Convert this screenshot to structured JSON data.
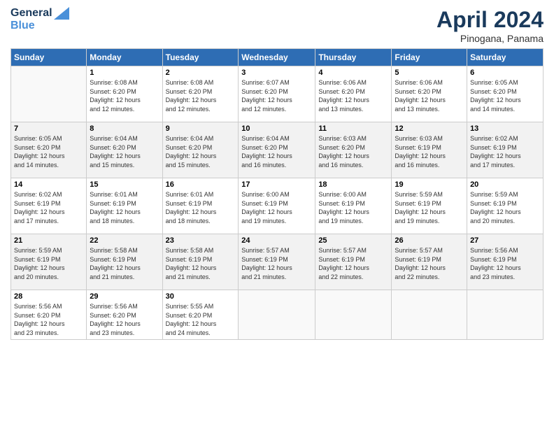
{
  "logo": {
    "line1": "General",
    "line2": "Blue"
  },
  "title": "April 2024",
  "subtitle": "Pinogana, Panama",
  "headers": [
    "Sunday",
    "Monday",
    "Tuesday",
    "Wednesday",
    "Thursday",
    "Friday",
    "Saturday"
  ],
  "weeks": [
    [
      {
        "day": "",
        "info": ""
      },
      {
        "day": "1",
        "info": "Sunrise: 6:08 AM\nSunset: 6:20 PM\nDaylight: 12 hours\nand 12 minutes."
      },
      {
        "day": "2",
        "info": "Sunrise: 6:08 AM\nSunset: 6:20 PM\nDaylight: 12 hours\nand 12 minutes."
      },
      {
        "day": "3",
        "info": "Sunrise: 6:07 AM\nSunset: 6:20 PM\nDaylight: 12 hours\nand 12 minutes."
      },
      {
        "day": "4",
        "info": "Sunrise: 6:06 AM\nSunset: 6:20 PM\nDaylight: 12 hours\nand 13 minutes."
      },
      {
        "day": "5",
        "info": "Sunrise: 6:06 AM\nSunset: 6:20 PM\nDaylight: 12 hours\nand 13 minutes."
      },
      {
        "day": "6",
        "info": "Sunrise: 6:05 AM\nSunset: 6:20 PM\nDaylight: 12 hours\nand 14 minutes."
      }
    ],
    [
      {
        "day": "7",
        "info": "Sunrise: 6:05 AM\nSunset: 6:20 PM\nDaylight: 12 hours\nand 14 minutes."
      },
      {
        "day": "8",
        "info": "Sunrise: 6:04 AM\nSunset: 6:20 PM\nDaylight: 12 hours\nand 15 minutes."
      },
      {
        "day": "9",
        "info": "Sunrise: 6:04 AM\nSunset: 6:20 PM\nDaylight: 12 hours\nand 15 minutes."
      },
      {
        "day": "10",
        "info": "Sunrise: 6:04 AM\nSunset: 6:20 PM\nDaylight: 12 hours\nand 16 minutes."
      },
      {
        "day": "11",
        "info": "Sunrise: 6:03 AM\nSunset: 6:20 PM\nDaylight: 12 hours\nand 16 minutes."
      },
      {
        "day": "12",
        "info": "Sunrise: 6:03 AM\nSunset: 6:19 PM\nDaylight: 12 hours\nand 16 minutes."
      },
      {
        "day": "13",
        "info": "Sunrise: 6:02 AM\nSunset: 6:19 PM\nDaylight: 12 hours\nand 17 minutes."
      }
    ],
    [
      {
        "day": "14",
        "info": "Sunrise: 6:02 AM\nSunset: 6:19 PM\nDaylight: 12 hours\nand 17 minutes."
      },
      {
        "day": "15",
        "info": "Sunrise: 6:01 AM\nSunset: 6:19 PM\nDaylight: 12 hours\nand 18 minutes."
      },
      {
        "day": "16",
        "info": "Sunrise: 6:01 AM\nSunset: 6:19 PM\nDaylight: 12 hours\nand 18 minutes."
      },
      {
        "day": "17",
        "info": "Sunrise: 6:00 AM\nSunset: 6:19 PM\nDaylight: 12 hours\nand 19 minutes."
      },
      {
        "day": "18",
        "info": "Sunrise: 6:00 AM\nSunset: 6:19 PM\nDaylight: 12 hours\nand 19 minutes."
      },
      {
        "day": "19",
        "info": "Sunrise: 5:59 AM\nSunset: 6:19 PM\nDaylight: 12 hours\nand 19 minutes."
      },
      {
        "day": "20",
        "info": "Sunrise: 5:59 AM\nSunset: 6:19 PM\nDaylight: 12 hours\nand 20 minutes."
      }
    ],
    [
      {
        "day": "21",
        "info": "Sunrise: 5:59 AM\nSunset: 6:19 PM\nDaylight: 12 hours\nand 20 minutes."
      },
      {
        "day": "22",
        "info": "Sunrise: 5:58 AM\nSunset: 6:19 PM\nDaylight: 12 hours\nand 21 minutes."
      },
      {
        "day": "23",
        "info": "Sunrise: 5:58 AM\nSunset: 6:19 PM\nDaylight: 12 hours\nand 21 minutes."
      },
      {
        "day": "24",
        "info": "Sunrise: 5:57 AM\nSunset: 6:19 PM\nDaylight: 12 hours\nand 21 minutes."
      },
      {
        "day": "25",
        "info": "Sunrise: 5:57 AM\nSunset: 6:19 PM\nDaylight: 12 hours\nand 22 minutes."
      },
      {
        "day": "26",
        "info": "Sunrise: 5:57 AM\nSunset: 6:19 PM\nDaylight: 12 hours\nand 22 minutes."
      },
      {
        "day": "27",
        "info": "Sunrise: 5:56 AM\nSunset: 6:19 PM\nDaylight: 12 hours\nand 23 minutes."
      }
    ],
    [
      {
        "day": "28",
        "info": "Sunrise: 5:56 AM\nSunset: 6:20 PM\nDaylight: 12 hours\nand 23 minutes."
      },
      {
        "day": "29",
        "info": "Sunrise: 5:56 AM\nSunset: 6:20 PM\nDaylight: 12 hours\nand 23 minutes."
      },
      {
        "day": "30",
        "info": "Sunrise: 5:55 AM\nSunset: 6:20 PM\nDaylight: 12 hours\nand 24 minutes."
      },
      {
        "day": "",
        "info": ""
      },
      {
        "day": "",
        "info": ""
      },
      {
        "day": "",
        "info": ""
      },
      {
        "day": "",
        "info": ""
      }
    ]
  ]
}
